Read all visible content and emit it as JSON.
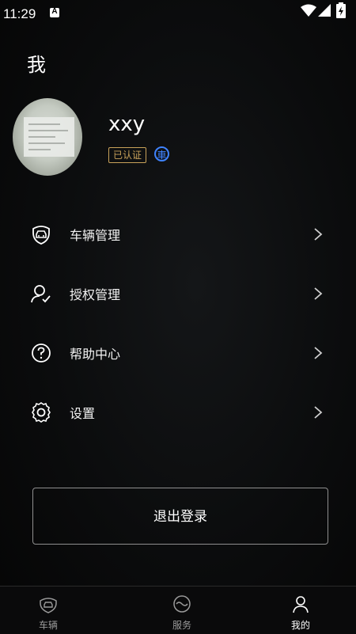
{
  "status_bar": {
    "time": "11:29",
    "notification_letter": "A"
  },
  "header": {
    "title": "我"
  },
  "profile": {
    "username": "xxy",
    "verified_label": "已认证",
    "vehicle_badge": "車"
  },
  "menu": [
    {
      "label": "车辆管理",
      "icon": "car-shield-icon"
    },
    {
      "label": "授权管理",
      "icon": "user-check-icon"
    },
    {
      "label": "帮助中心",
      "icon": "help-circle-icon"
    },
    {
      "label": "设置",
      "icon": "gear-icon"
    }
  ],
  "logout": {
    "label": "退出登录"
  },
  "tabs": [
    {
      "label": "车辆",
      "icon": "car-icon",
      "active": false
    },
    {
      "label": "服务",
      "icon": "service-icon",
      "active": false
    },
    {
      "label": "我的",
      "icon": "profile-icon",
      "active": true
    }
  ],
  "colors": {
    "background": "#0b0c0d",
    "verified": "#c9a25a",
    "vehicle_badge": "#3f83ff"
  }
}
